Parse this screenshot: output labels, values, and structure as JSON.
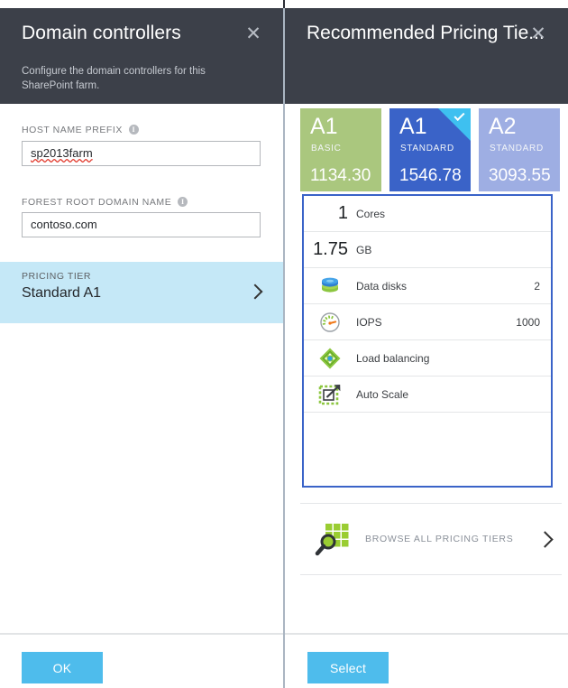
{
  "left_blade": {
    "title": "Domain controllers",
    "close_icon": "✕",
    "description": "Configure the domain controllers for this SharePoint farm.",
    "fields": [
      {
        "label": "HOST NAME PREFIX",
        "value": "sp2013farm",
        "has_info_icon": true,
        "spellcheck_error": true
      },
      {
        "label": "FOREST ROOT DOMAIN NAME",
        "value": "contoso.com",
        "has_info_icon": true,
        "spellcheck_error": false
      }
    ],
    "pricing_tier_row": {
      "label": "PRICING TIER",
      "value": "Standard A1",
      "chevron_icon": "chevron-right-icon",
      "background_color": "#c5e8f7"
    },
    "ok_button": "OK"
  },
  "right_blade": {
    "title": "Recommended Pricing Tie...",
    "close_icon": "✕",
    "cards": [
      {
        "name": "A1",
        "type": "BASIC",
        "price": "1134.30",
        "color": "#aac77e",
        "selected": false
      },
      {
        "name": "A1",
        "type": "STANDARD",
        "price": "1546.78",
        "color": "#3a63c8",
        "selected": true
      },
      {
        "name": "A2",
        "type": "STANDARD",
        "price": "3093.55",
        "color": "#9eaee3",
        "selected": false
      }
    ],
    "spec_panel": {
      "border_color": "#3a63c8",
      "rows": [
        {
          "number": "1",
          "icon": null,
          "label": "Cores",
          "value": ""
        },
        {
          "number": "1.75",
          "icon": null,
          "label": "GB",
          "value": ""
        },
        {
          "number": "",
          "icon": "data-disks-icon",
          "label": "Data disks",
          "value": "2"
        },
        {
          "number": "",
          "icon": "iops-gauge-icon",
          "label": "IOPS",
          "value": "1000"
        },
        {
          "number": "",
          "icon": "load-balancing-icon",
          "label": "Load balancing",
          "value": ""
        },
        {
          "number": "",
          "icon": "auto-scale-icon",
          "label": "Auto Scale",
          "value": ""
        }
      ]
    },
    "browse_row": {
      "label": "BROWSE ALL PRICING TIERS",
      "icon": "browse-search-grid-icon",
      "chevron_icon": "chevron-right-icon"
    },
    "select_button": "Select"
  }
}
